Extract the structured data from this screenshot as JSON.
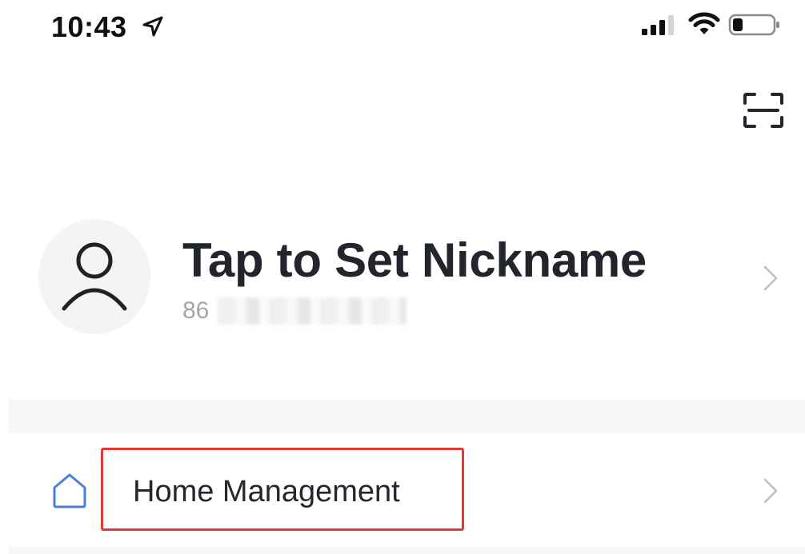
{
  "status_bar": {
    "time": "10:43",
    "icons": [
      "location-arrow-icon",
      "cellular-signal-icon",
      "wifi-icon",
      "battery-icon"
    ]
  },
  "header": {
    "scan_icon": "scan-icon"
  },
  "profile": {
    "nickname": "Tap to Set Nickname",
    "phone_visible": "86",
    "avatar_icon": "user-icon"
  },
  "menu": {
    "items": [
      {
        "label": "Home Management",
        "icon": "home-icon",
        "highlighted": true
      }
    ]
  },
  "colors": {
    "highlight": "#e23a33",
    "home_icon": "#4a7fd6",
    "muted_text": "#a4a6aa"
  }
}
